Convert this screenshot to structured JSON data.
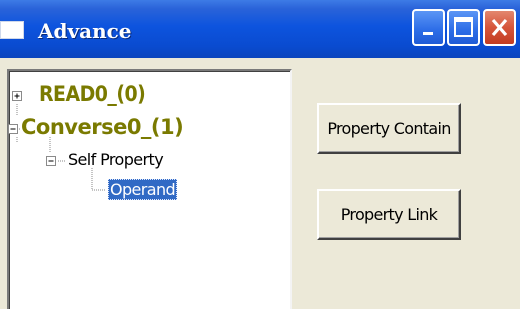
{
  "window": {
    "title": "Advance"
  },
  "tree": {
    "nodes": [
      {
        "label": "READ0_(0)",
        "expander": "plus"
      },
      {
        "label": "Converse0_(1)",
        "expander": "minus"
      },
      {
        "label": "Self Property",
        "expander": "minus"
      },
      {
        "label": "Operand",
        "selected": true
      }
    ]
  },
  "buttons": {
    "property_contain": "Property Contain",
    "property_link": "Property Link"
  },
  "colors": {
    "titlebar": "#0a4bd0",
    "root_node_text": "#7a7a00",
    "selection": "#316ac5",
    "close_button": "#d6553a"
  }
}
